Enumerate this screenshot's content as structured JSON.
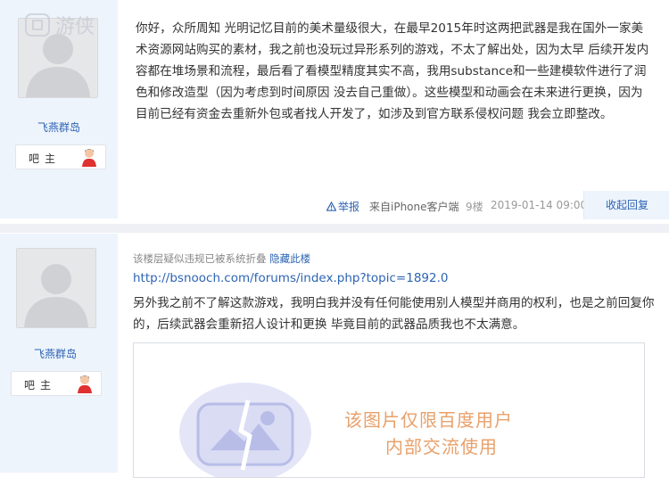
{
  "watermark": {
    "text": "游侠"
  },
  "post1": {
    "username": "飞燕群岛",
    "role": "吧主",
    "content": "你好，众所周知 光明记忆目前的美术量级很大，在最早2015年时这两把武器是我在国外一家美术资源网站购买的素材，我之前也没玩过异形系列的游戏，不太了解出处，因为太早 后续开发内容都在堆场景和流程，最后看了看模型精度其实不高，我用substance和一些建模软件进行了润色和修改造型（因为考虑到时间原因 没去自己重做）。这些模型和动画会在未来进行更换，因为目前已经有资金去重新外包或者找人开发了，如涉及到官方联系侵权问题 我会立即整改。",
    "footer": {
      "report": "举报",
      "source": "来自iPhone客户端",
      "floor": "9楼",
      "time": "2019-01-14 09:00",
      "reply": "收起回复"
    }
  },
  "post2": {
    "username": "飞燕群岛",
    "role": "吧主",
    "notice": "该楼层疑似违规已被系统折叠",
    "hide_link": "隐藏此楼",
    "url": "http://bsnooch.com/forums/index.php?topic=1892.0",
    "content": "另外我之前不了解这款游戏，我明白我并没有任何能使用别人模型并商用的权利，也是之前回复你的，后续武器会重新招人设计和更换 毕竟目前的武器品质我也不太满意。",
    "image": {
      "line1": "该图片仅限百度用户",
      "line2": "内部交流使用"
    }
  },
  "colors": {
    "link": "#2d64b3",
    "sidebar_bg": "#eef4fc",
    "watermark_text": "#e8a06a"
  }
}
